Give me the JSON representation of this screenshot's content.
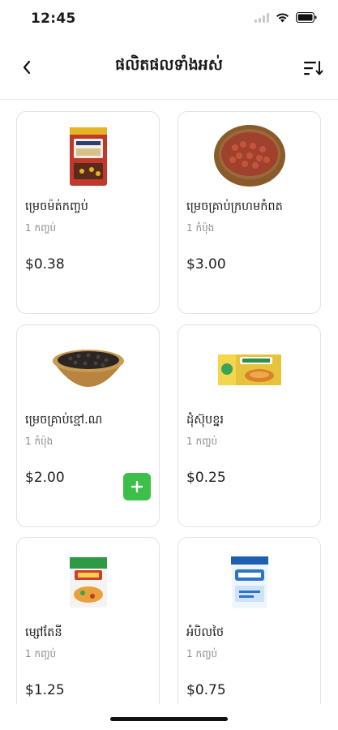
{
  "status": {
    "time": "12:45"
  },
  "header": {
    "title": "ផលិតផលទាំងអស់"
  },
  "colors": {
    "accent": "#3cc04a",
    "border": "#e3e3e3",
    "muted": "#8c8c8c"
  },
  "products": [
    {
      "name": "ម្រេចម៉ត់កញ្ចប់",
      "unit": "1 កញ្ចប់",
      "price": "$0.38",
      "icon": "pepper-packet-icon"
    },
    {
      "name": "ម្រេចគ្រាប់ក្រហមកំពត",
      "unit": "1 កំប៉ុង",
      "price": "$3.00",
      "icon": "red-pepper-bowl-icon"
    },
    {
      "name": "ម្រេចគ្រាប់ខ្មៅ.ណ",
      "unit": "1 កំប៉ុង",
      "price": "$2.00",
      "icon": "black-pepper-bowl-icon"
    },
    {
      "name": "ដុំស៊ុបខ្នរ",
      "unit": "1 កញ្ចប់",
      "price": "$0.25",
      "icon": "soup-cube-box-icon"
    },
    {
      "name": "ម្សៅតែនី",
      "unit": "1 កញ្ចប់",
      "price": "$1.25",
      "icon": "seasoning-packet-icon"
    },
    {
      "name": "អំបិលថៃ",
      "unit": "1 កញ្ចប់",
      "price": "$0.75",
      "icon": "salt-bag-icon"
    }
  ]
}
